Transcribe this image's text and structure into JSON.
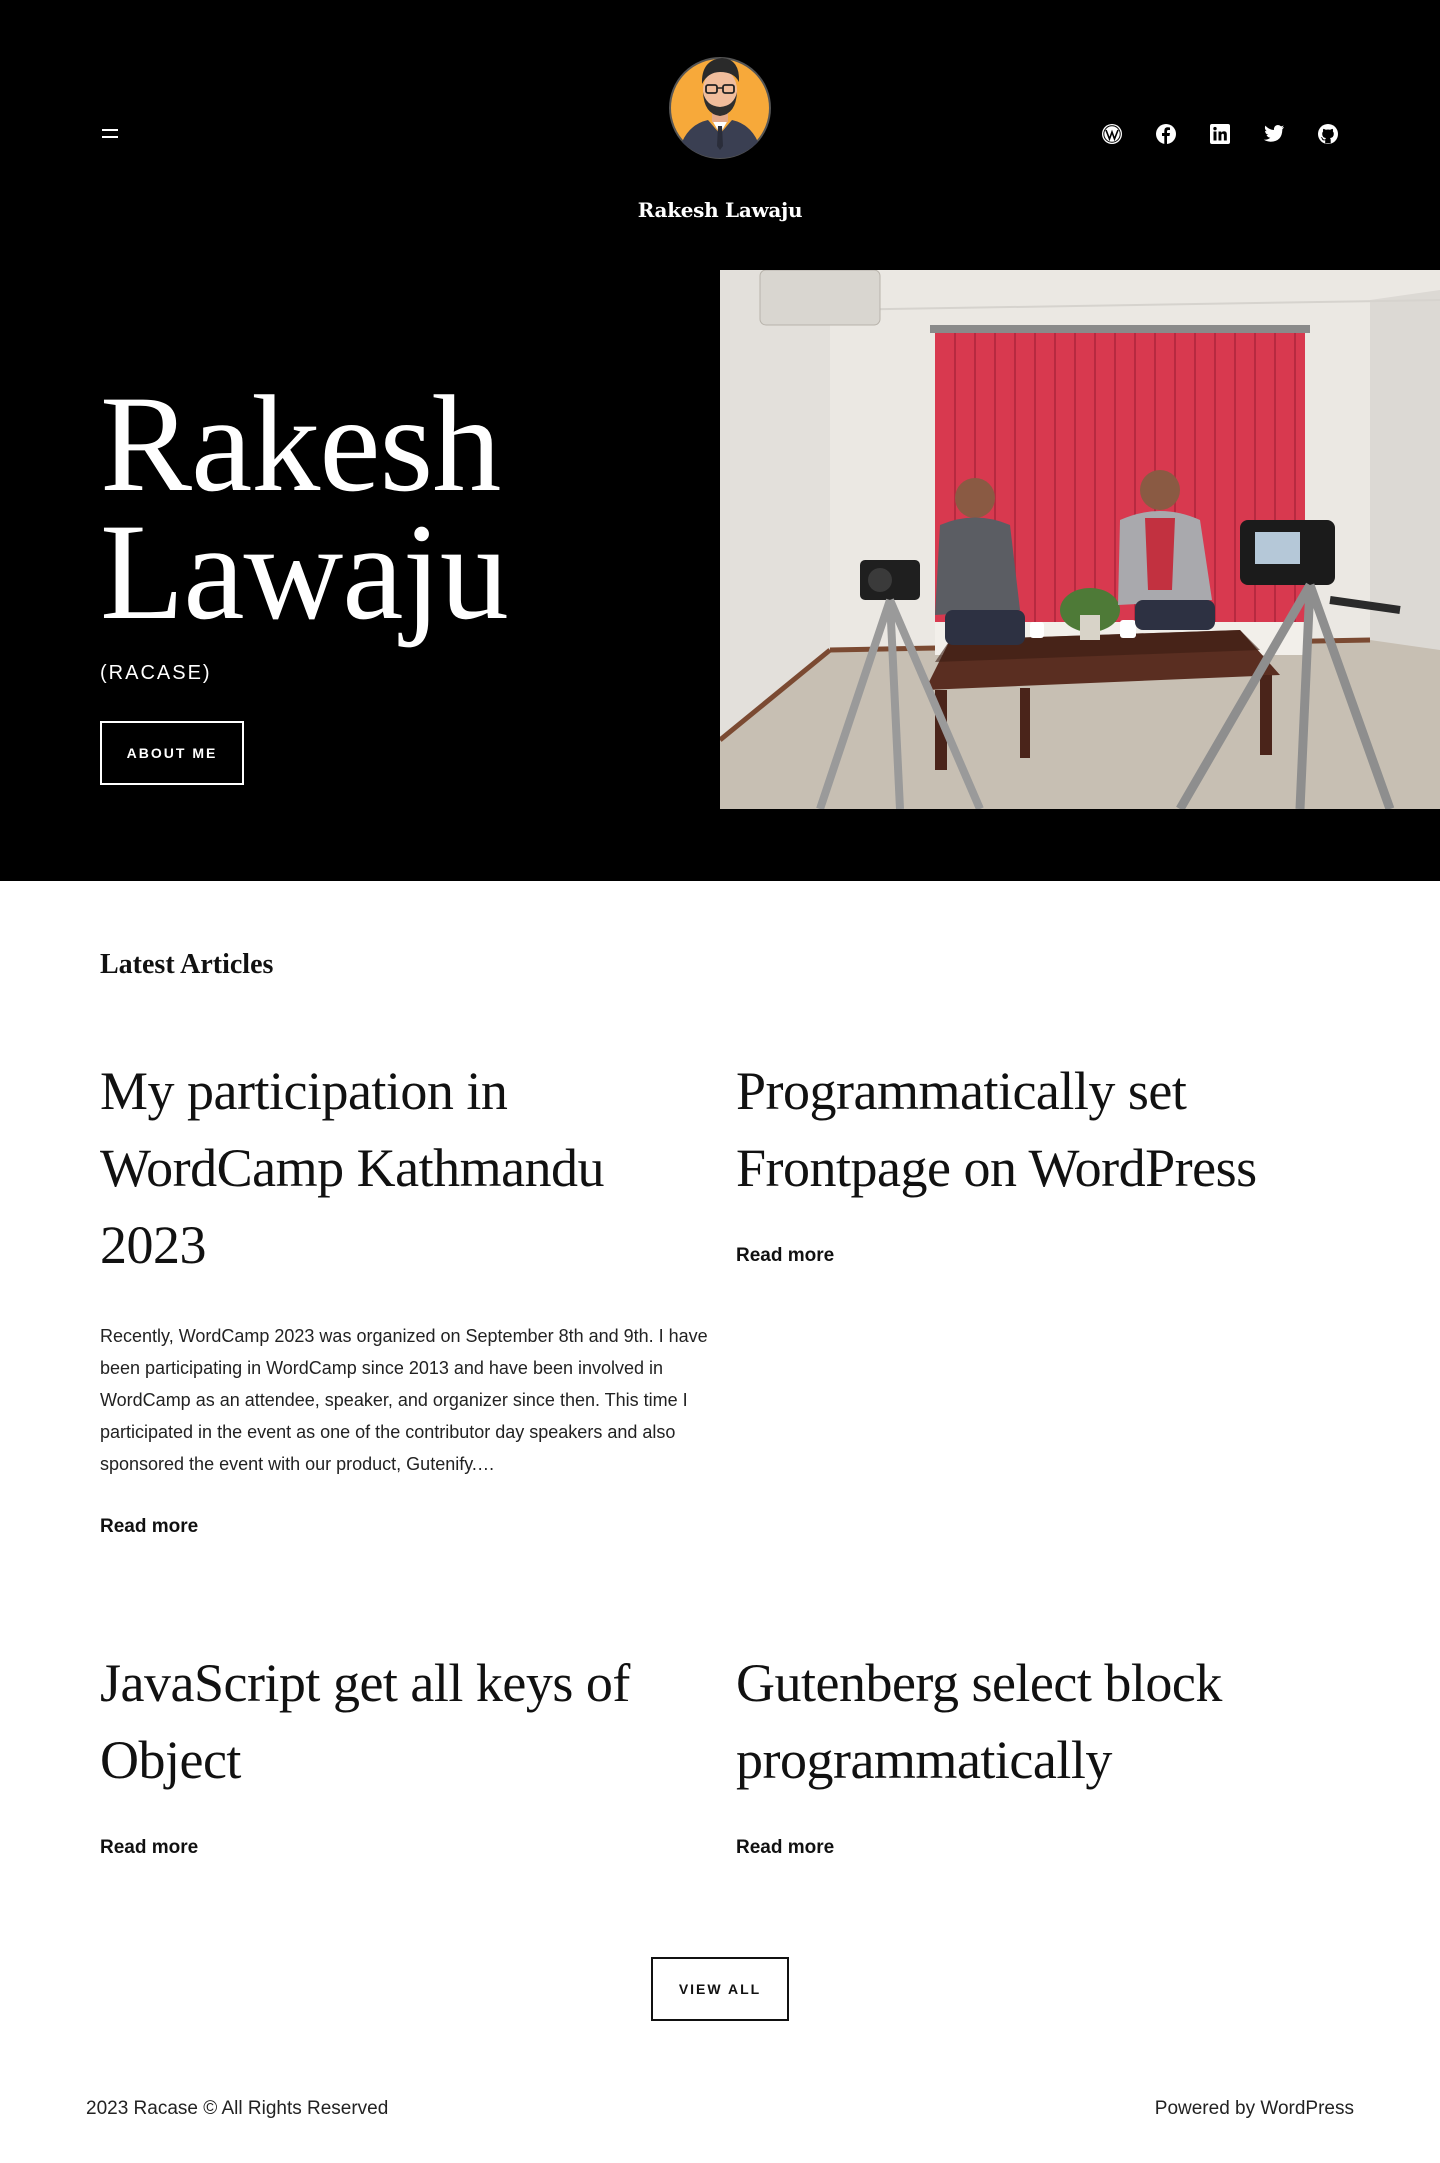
{
  "header": {
    "site_title": "Rakesh Lawaju",
    "social_icons": [
      "wordpress-icon",
      "facebook-icon",
      "linkedin-icon",
      "twitter-icon",
      "github-icon"
    ]
  },
  "hero": {
    "name_line1": "Rakesh",
    "name_line2": "Lawaju",
    "subtitle": "(RACASE)",
    "about_button": "ABOUT ME"
  },
  "articles": {
    "section_title": "Latest Articles",
    "posts": [
      {
        "title": "My participation in WordCamp Kathmandu 2023",
        "excerpt": "Recently, WordCamp 2023 was organized on September 8th and 9th. I have been participating in WordCamp since 2013 and have been involved in WordCamp as an attendee, speaker, and organizer since then. This time I participated in the event as one of the contributor day speakers and also sponsored the event with our product, Gutenify.…",
        "read_more": "Read more"
      },
      {
        "title": "Programmatically set Frontpage on WordPress",
        "read_more": "Read more"
      },
      {
        "title": "JavaScript get all keys of Object",
        "read_more": "Read more"
      },
      {
        "title": "Gutenberg select block programmatically",
        "read_more": "Read more"
      }
    ],
    "view_all_button": "VIEW ALL"
  },
  "footer": {
    "copyright": "2023 Racase © All Rights Reserved",
    "powered_by": "Powered by WordPress"
  },
  "colors": {
    "hero_background": "#000000",
    "page_background": "#ffffff",
    "curtain_red": "#d8394f",
    "avatar_orange": "#f7a93a"
  }
}
